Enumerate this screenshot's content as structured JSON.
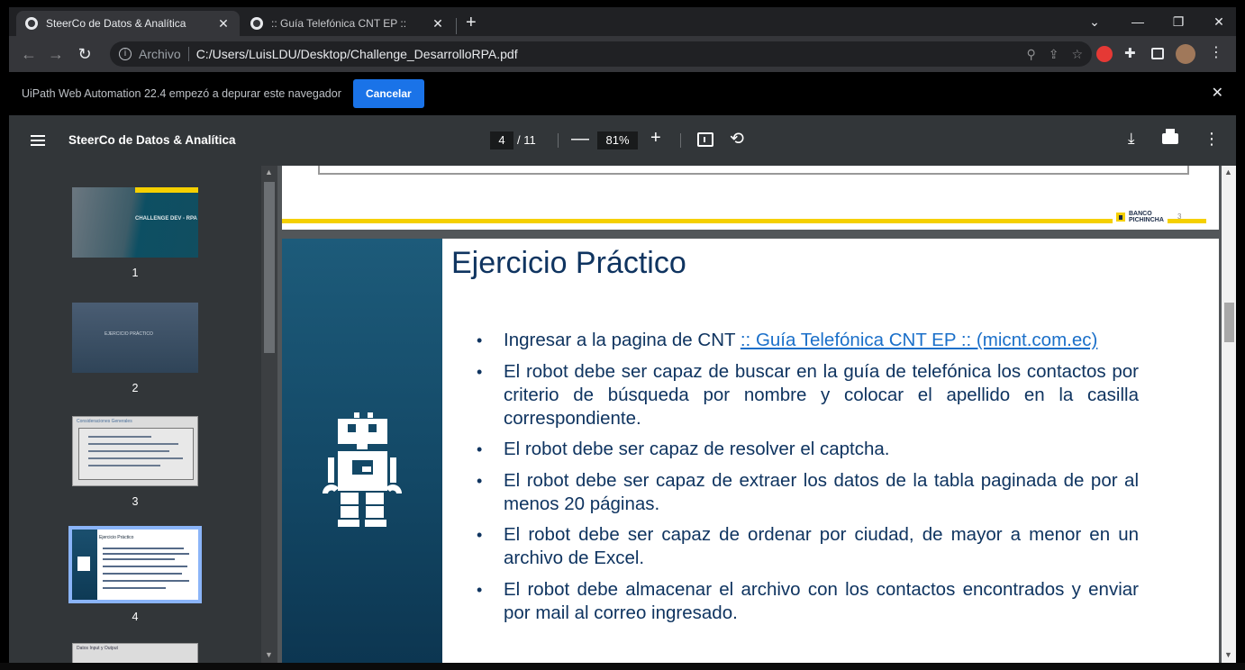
{
  "browser": {
    "tabs": [
      {
        "title": "SteerCo de Datos & Analítica",
        "active": true
      },
      {
        "title": ":: Guía Telefónica CNT EP ::",
        "active": false
      }
    ],
    "new_tab": "+",
    "window_controls": {
      "dropdown": "⌄",
      "minimize": "—",
      "restore": "❐",
      "close": "✕"
    },
    "address": {
      "scheme": "Archivo",
      "url": "C:/Users/LuisLDU/Desktop/Challenge_DesarrolloRPA.pdf"
    }
  },
  "infobar": {
    "message": "UiPath Web Automation 22.4 empezó a depurar este navegador",
    "cancel_label": "Cancelar",
    "close": "✕"
  },
  "pdf_toolbar": {
    "title": "SteerCo de Datos & Analítica",
    "current_page": "4",
    "total_pages": "/ 11",
    "zoom": "81%",
    "zoom_out": "—",
    "zoom_in": "+"
  },
  "thumbnails": [
    {
      "page": "1",
      "label": "CHALLENGE DEV - RPA"
    },
    {
      "page": "2",
      "label": "EJERCICIO PRÁCTICO"
    },
    {
      "page": "3",
      "label": "Consideraciones Generales"
    },
    {
      "page": "4",
      "label": "Ejercicio Práctico",
      "selected": true
    },
    {
      "page": "5",
      "label": "Datos Input y Output"
    }
  ],
  "page3": {
    "logo_line1": "BANCO",
    "logo_line2": "PICHINCHA",
    "page_number": "3"
  },
  "page4": {
    "title": "Ejercicio Práctico",
    "bullet1_prefix": "Ingresar a la pagina de CNT ",
    "bullet1_link": ":: Guía Telefónica CNT EP :: (micnt.com.ec)",
    "bullets": [
      "El robot debe ser capaz de buscar en la guía de telefónica los contactos por criterio de búsqueda por nombre y colocar el apellido en la casilla correspondiente.",
      "El robot debe ser capaz de resolver el captcha.",
      "El robot debe ser capaz de extraer los datos de la tabla paginada de por al menos 20 páginas.",
      "El robot debe ser capaz de ordenar por ciudad, de mayor a menor en un archivo de Excel.",
      "El robot debe almacenar el archivo con los contactos encontrados y enviar por mail al correo ingresado."
    ]
  },
  "colors": {
    "accent_blue": "#1a73e8",
    "brand_yellow": "#f5d000",
    "slide_text": "#0f3460",
    "link": "#1a6fc9"
  }
}
